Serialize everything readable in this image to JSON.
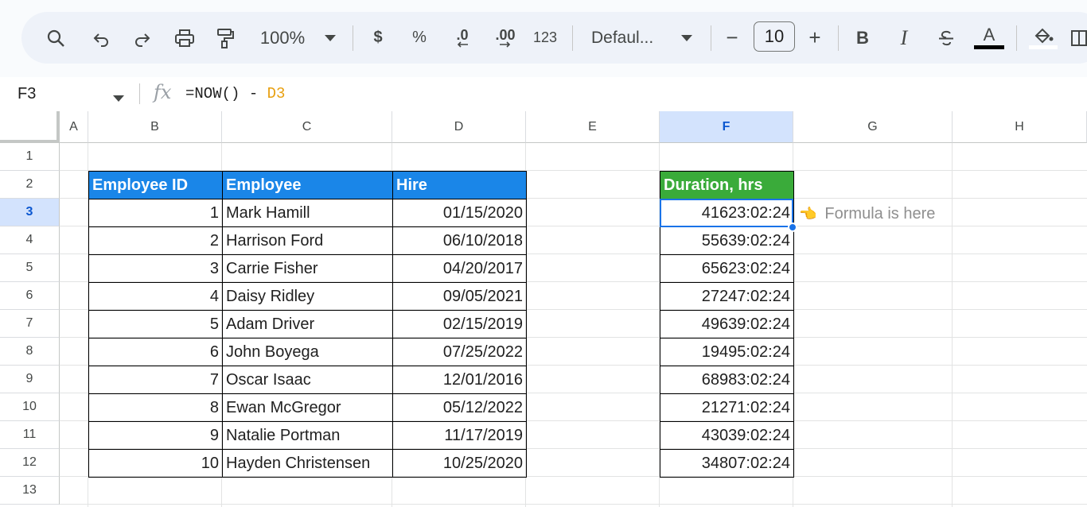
{
  "toolbar": {
    "zoom": "100%",
    "currency": "$",
    "percent": "%",
    "decrease_decimal": ".0",
    "increase_decimal": ".00",
    "number_format": "123",
    "font_name": "Defaul...",
    "font_size": "10",
    "minus": "−",
    "plus": "+",
    "bold": "B",
    "italic": "I",
    "text_color_letter": "A",
    "icons": [
      "search-icon",
      "undo-icon",
      "redo-icon",
      "print-icon",
      "paint-format-icon",
      "chevron-down-icon",
      "fill-color-icon",
      "strikethrough-icon",
      "borders-icon"
    ]
  },
  "formula_bar": {
    "name_box": "F3",
    "fx": "fx",
    "formula_prefix": "=NOW() - ",
    "formula_ref": "D3"
  },
  "columns": [
    "A",
    "B",
    "C",
    "D",
    "E",
    "F",
    "G",
    "H"
  ],
  "rows": [
    "1",
    "2",
    "3",
    "4",
    "5",
    "6",
    "7",
    "8",
    "9",
    "10",
    "11",
    "12",
    "13"
  ],
  "table": {
    "headers": {
      "id": "Employee ID",
      "employee": "Employee",
      "hire": "Hire"
    },
    "rows": [
      {
        "id": "1",
        "name": "Mark Hamill",
        "hire": "01/15/2020"
      },
      {
        "id": "2",
        "name": "Harrison Ford",
        "hire": "06/10/2018"
      },
      {
        "id": "3",
        "name": "Carrie Fisher",
        "hire": "04/20/2017"
      },
      {
        "id": "4",
        "name": "Daisy Ridley",
        "hire": "09/05/2021"
      },
      {
        "id": "5",
        "name": "Adam Driver",
        "hire": "02/15/2019"
      },
      {
        "id": "6",
        "name": "John Boyega",
        "hire": "07/25/2022"
      },
      {
        "id": "7",
        "name": "Oscar Isaac",
        "hire": "12/01/2016"
      },
      {
        "id": "8",
        "name": "Ewan McGregor",
        "hire": "05/12/2022"
      },
      {
        "id": "9",
        "name": "Natalie Portman",
        "hire": "11/17/2019"
      },
      {
        "id": "10",
        "name": "Hayden Christensen",
        "hire": "10/25/2020"
      }
    ]
  },
  "duration": {
    "header": "Duration, hrs",
    "values": [
      "41623:02:24",
      "55639:02:24",
      "65623:02:24",
      "27247:02:24",
      "49639:02:24",
      "19495:02:24",
      "68983:02:24",
      "21271:02:24",
      "43039:02:24",
      "34807:02:24"
    ]
  },
  "note": {
    "hand": "👈",
    "text": "Formula is here"
  },
  "selected_cell": {
    "column": "F",
    "row": "3"
  },
  "colors": {
    "header_blue": "#1a86e8",
    "header_green": "#3aab3a",
    "selection": "#1a73e8",
    "formula_ref": "#e8a010"
  }
}
